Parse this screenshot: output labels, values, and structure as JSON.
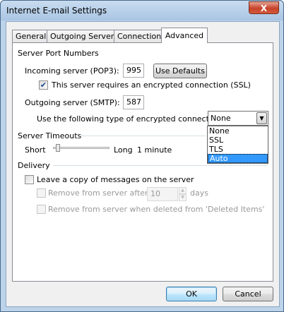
{
  "window": {
    "title": "Internet E-mail Settings",
    "close_glyph": "X"
  },
  "tabs": [
    {
      "label": "General"
    },
    {
      "label": "Outgoing Server"
    },
    {
      "label": "Connection"
    },
    {
      "label": "Advanced"
    }
  ],
  "server_ports": {
    "group_label": "Server Port Numbers",
    "incoming_label": "Incoming server (POP3):",
    "incoming_value": "995",
    "use_defaults_label": "Use Defaults",
    "ssl_checkbox_label": "This server requires an encrypted connection (SSL)",
    "ssl_checked": true,
    "outgoing_label": "Outgoing server (SMTP):",
    "outgoing_value": "587",
    "encryption_label": "Use the following type of encrypted connection:",
    "encryption_value": "None",
    "encryption_options": [
      "None",
      "SSL",
      "TLS",
      "Auto"
    ],
    "encryption_highlighted": "Auto"
  },
  "timeouts": {
    "group_label": "Server Timeouts",
    "short_label": "Short",
    "long_label": "Long",
    "value_text": "1 minute",
    "slider_level": 0.05
  },
  "delivery": {
    "group_label": "Delivery",
    "leave_copy_label": "Leave a copy of messages on the server",
    "remove_after_label": "Remove from server after",
    "remove_after_value": "10",
    "days_label": "days",
    "remove_deleted_label": "Remove from server when deleted from 'Deleted Items'"
  },
  "footer": {
    "ok_label": "OK",
    "cancel_label": "Cancel"
  }
}
